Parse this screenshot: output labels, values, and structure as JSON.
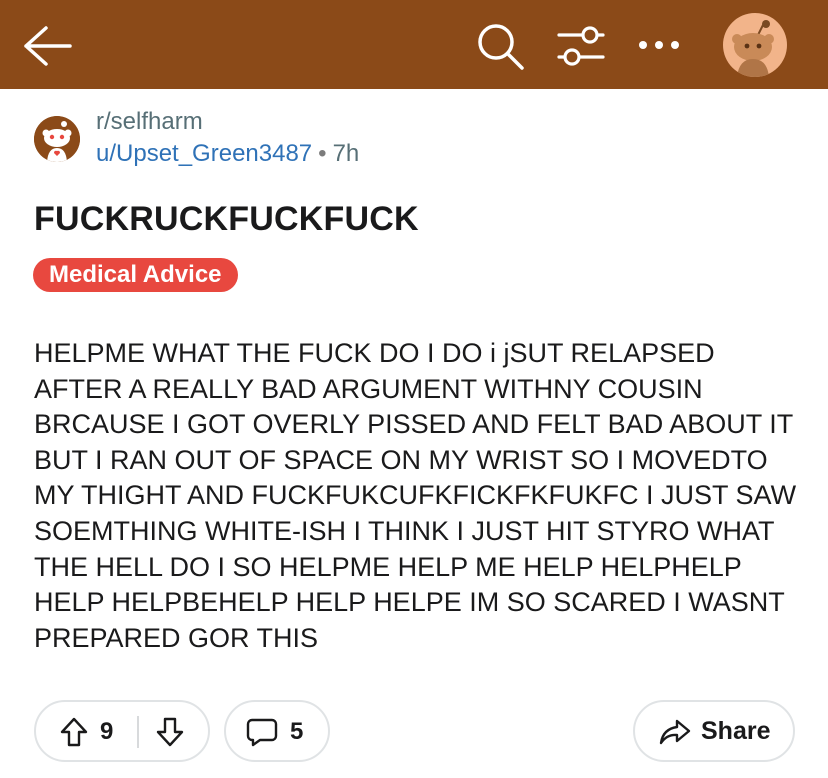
{
  "colors": {
    "header_bg": "#8b4a18",
    "flair_bg": "#e8483f",
    "username": "#2f72b7"
  },
  "header": {
    "icons": [
      "back-arrow-icon",
      "search-icon",
      "filter-icon",
      "more-icon",
      "user-avatar"
    ]
  },
  "post": {
    "subreddit": "r/selfharm",
    "author": "u/Upset_Green3487",
    "separator": "•",
    "age": "7h",
    "title": "FUCKRUCKFUCKFUCK",
    "flair": "Medical Advice",
    "body": "HELPME WHAT THE FUCK DO I DO i jSUT RELAPSED AFTER A REALLY BAD ARGUMENT WITHNY COUSIN BRCAUSE I GOT OVERLY PISSED AND FELT BAD ABOUT IT BUT I RAN OUT OF SPACE ON MY WRIST SO I MOVEDTO MY THIGHT AND FUCKFUKCUFKFICKFKFUKFC I JUST SAW SOEMTHING WHITE-ISH I THINK I JUST HIT STYRO WHAT THE HELL DO I SO HELPME HELP ME HELP HELPHELP HELP HELPBEHELP HELP HELPE IM SO SCARED I WASNT PREPARED GOR THIS"
  },
  "actions": {
    "vote_count": "9",
    "comment_count": "5",
    "share_label": "Share"
  }
}
